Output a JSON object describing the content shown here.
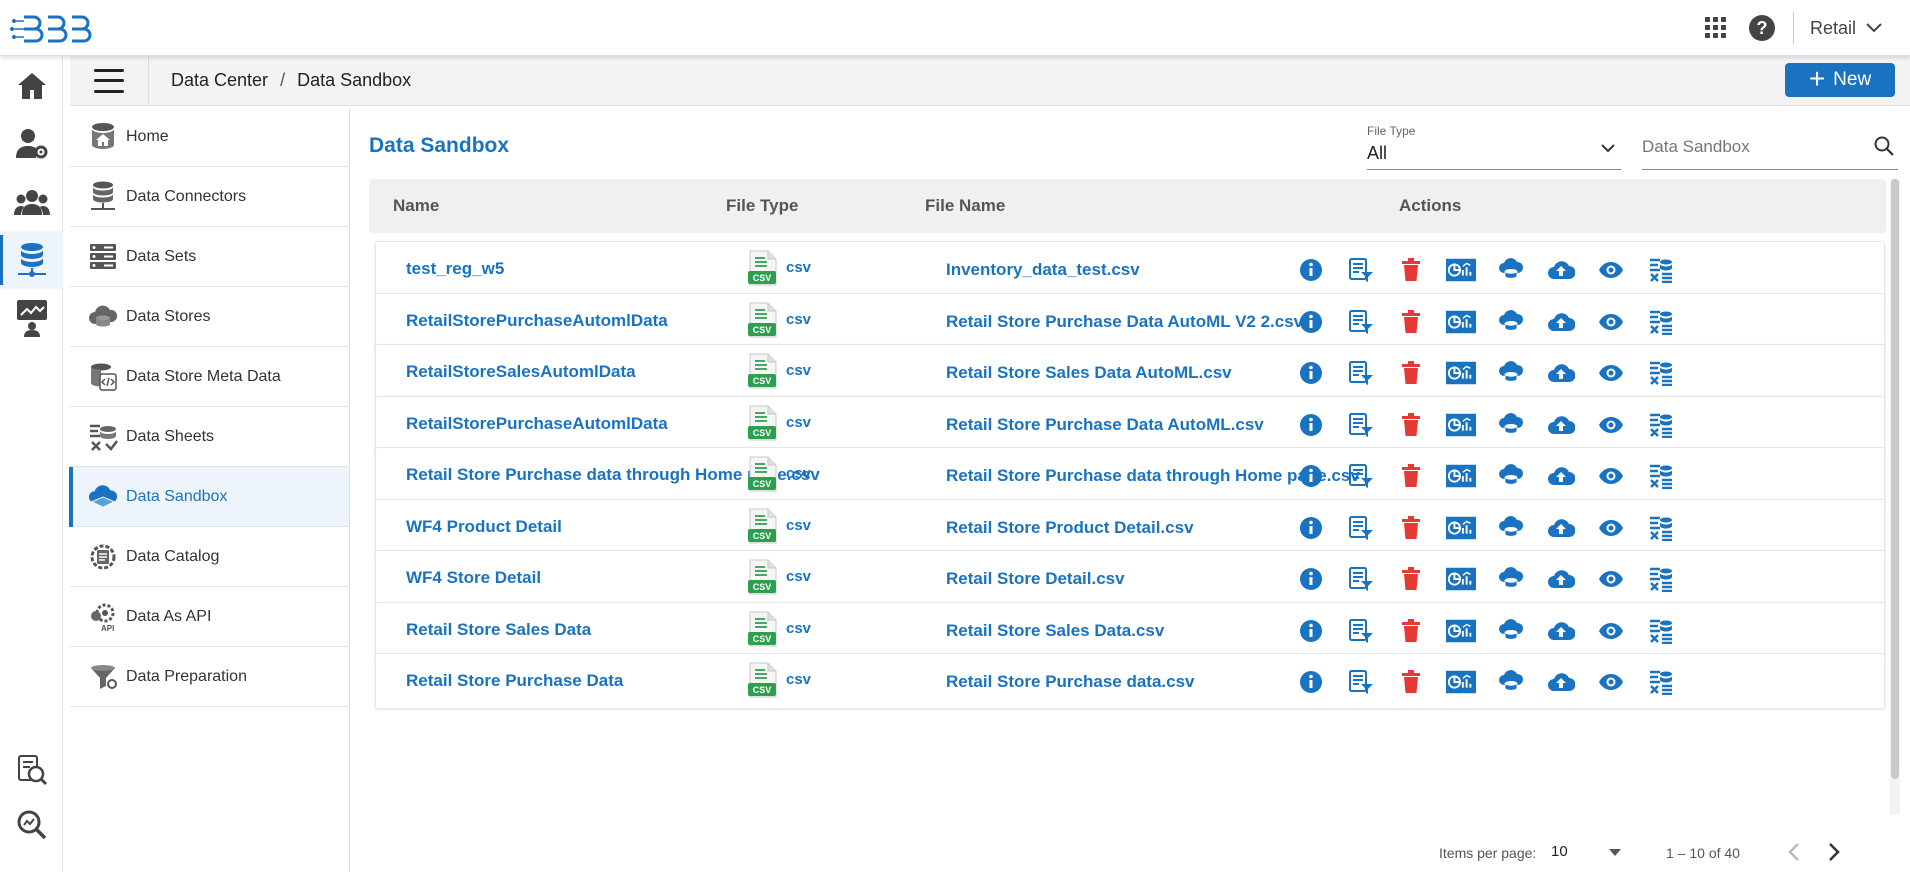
{
  "header": {
    "account_label": "Retail",
    "icons": [
      "apps-grid-icon",
      "help-icon",
      "chevron-down-icon"
    ]
  },
  "rail": {
    "items": [
      "home-icon",
      "user-settings-icon",
      "group-icon",
      "database-icon",
      "dashboard-user-icon",
      "search-doc-icon",
      "search-zoom-icon"
    ],
    "active_index": 3
  },
  "breadcrumb": {
    "first": "Data Center",
    "separator": "/",
    "current": "Data Sandbox"
  },
  "toolbar": {
    "new_label": "New"
  },
  "subnav": {
    "items": [
      {
        "label": "Home",
        "icon": "db-home-icon"
      },
      {
        "label": "Data Connectors",
        "icon": "db-connector-icon"
      },
      {
        "label": "Data Sets",
        "icon": "server-icon"
      },
      {
        "label": "Data Stores",
        "icon": "cloud-db-icon"
      },
      {
        "label": "Data Store Meta Data",
        "icon": "db-code-icon"
      },
      {
        "label": "Data Sheets",
        "icon": "data-sheet-icon"
      },
      {
        "label": "Data Sandbox",
        "icon": "cloud-sandbox-icon"
      },
      {
        "label": "Data Catalog",
        "icon": "catalog-icon"
      },
      {
        "label": "Data As API",
        "icon": "api-gear-icon"
      },
      {
        "label": "Data Preparation",
        "icon": "prep-icon"
      }
    ],
    "active_index": 6
  },
  "main": {
    "title": "Data Sandbox",
    "filter": {
      "label": "File Type",
      "value": "All"
    },
    "search": {
      "placeholder": "Data Sandbox"
    }
  },
  "table": {
    "columns": [
      "Name",
      "File Type",
      "File Name",
      "Actions"
    ],
    "rows": [
      {
        "name": "test_reg_w5",
        "type": "csv",
        "file": "Inventory_data_test.csv"
      },
      {
        "name": "RetailStorePurchaseAutomlData",
        "type": "csv",
        "file": "Retail Store Purchase Data AutoML V2 2.csv"
      },
      {
        "name": "RetailStoreSalesAutomlData",
        "type": "csv",
        "file": "Retail Store Sales Data AutoML.csv"
      },
      {
        "name": "RetailStorePurchaseAutomlData",
        "type": "csv",
        "file": "Retail Store Purchase Data AutoML.csv"
      },
      {
        "name": "Retail Store Purchase data through Home page.csv",
        "type": "csv",
        "file": "Retail Store Purchase data through Home page.csv"
      },
      {
        "name": "WF4 Product Detail",
        "type": "csv",
        "file": "Retail Store Product Detail.csv"
      },
      {
        "name": "WF4 Store Detail",
        "type": "csv",
        "file": "Retail Store Detail.csv"
      },
      {
        "name": "Retail Store Sales Data",
        "type": "csv",
        "file": "Retail Store Sales Data.csv"
      },
      {
        "name": "Retail Store Purchase Data",
        "type": "csv",
        "file": "Retail Store Purchase data.csv"
      }
    ],
    "file_icon_text": "CSV",
    "action_icons": [
      "info-icon",
      "doc-filter-icon",
      "delete-icon",
      "analytics-icon",
      "cloud-db-icon",
      "upload-cloud-icon",
      "view-eye-icon",
      "data-clear-icon"
    ]
  },
  "paginator": {
    "items_label": "Items per page:",
    "page_size": "10",
    "range": "1 – 10 of 40"
  },
  "colors": {
    "accent": "#1a73c1",
    "danger": "#e53935",
    "csv_green": "#2e9e4f"
  }
}
